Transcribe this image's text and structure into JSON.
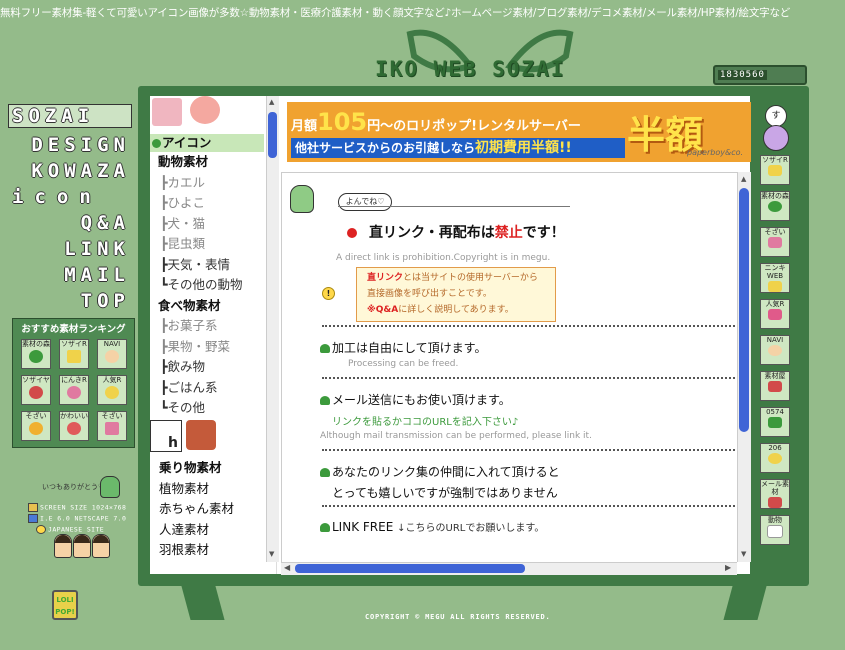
{
  "header": {
    "top_text": "無料フリー素材集-軽くて可愛いアイコン画像が多数☆動物素材・医療介護素材・動く顔文字など♪ホームページ素材/ブログ素材/デコメ素材/メール素材/HP素材/絵文字など",
    "logo": "IKO WEB SOZAI",
    "counter": "1830560"
  },
  "left_nav": {
    "items": [
      {
        "label": "SOZAI",
        "active": true
      },
      {
        "label": "DESIGN",
        "active": false
      },
      {
        "label": "KOWAZA",
        "active": false
      },
      {
        "label": "icon",
        "active": false
      },
      {
        "label": "Q&A",
        "active": false
      },
      {
        "label": "LINK",
        "active": false
      },
      {
        "label": "MAIL",
        "active": false
      },
      {
        "label": "TOP",
        "active": false
      }
    ]
  },
  "ranking": {
    "title": "おすすめ素材ランキング",
    "badges": [
      "素材の森",
      "ソザイR",
      "NAVI",
      "ソザイヤ",
      "にんきR",
      "人気R",
      "そざい",
      "かわいい",
      "そざい"
    ]
  },
  "site_info": {
    "thanks": "いつもありがとう♡",
    "screen": "SCREEN SIZE 1024×768",
    "browser": "I.E 6.0 NETSCAPE 7.0",
    "site": "JAPANESE SITE",
    "host_badge": "LOLI POP!"
  },
  "sidebar": {
    "list1": [
      {
        "label": "アイコン",
        "type": "head"
      },
      {
        "label": "動物素材",
        "type": "bold"
      },
      {
        "label": "┣カエル",
        "type": "sub"
      },
      {
        "label": "┣ひよこ",
        "type": "sub"
      },
      {
        "label": "┣犬・猫",
        "type": "sub"
      },
      {
        "label": "┣昆虫類",
        "type": "sub"
      },
      {
        "label": "┣天気・表情",
        "type": "sub-dark"
      },
      {
        "label": "┗その他の動物",
        "type": "sub-dark"
      },
      {
        "label": "食べ物素材",
        "type": "bold"
      },
      {
        "label": "┣お菓子系",
        "type": "sub"
      },
      {
        "label": "┣果物・野菜",
        "type": "sub"
      },
      {
        "label": "┣飲み物",
        "type": "sub-dark"
      },
      {
        "label": "┣ごはん系",
        "type": "sub-dark"
      },
      {
        "label": "┗その他",
        "type": "sub-dark"
      }
    ],
    "list2": [
      "乗り物素材",
      "植物素材",
      "赤ちゃん素材",
      "人達素材",
      "羽根素材"
    ]
  },
  "banner": {
    "line1_pre": "月額",
    "line1_price": "105",
    "line1_post": "円〜のロリポップ!レンタルサーバー",
    "line2_pre": "他社サービスからのお引越しなら",
    "line2_hl": "初期費用半額!!",
    "big": "半額",
    "brand": "paperboy&co."
  },
  "content": {
    "cloud": "よんでね♡",
    "warning_pre": "直リンク・再配布は",
    "warning_red": "禁止",
    "warning_post": "です！",
    "warning_en": "A direct link is prohibition.Copyright is in megu.",
    "notice": {
      "l1_red": "直リンク",
      "l1_rest": "とは当サイトの使用サーバーから",
      "l2": "直接画像を呼び出すことです。",
      "l3_red": "※Q&A",
      "l3_rest": "に詳しく説明してあります。"
    },
    "item1": "加工は自由にして頂けます。",
    "item1_en": "Processing can be freed.",
    "item2": "メール送信にもお使い頂けます。",
    "item2_jp": "リンクを貼るかココのURLを記入下さい♪",
    "item2_en": "Although mail transmission can be performed, please link it.",
    "item3_l1": "あなたのリンク集の仲間に入れて頂けると",
    "item3_l2": "とっても嬉しいですが強制ではありません",
    "item4": "LINK FREE",
    "item4_note": "↓こちらのURLでお願いします。"
  },
  "right_buttons": [
    "ソザイR",
    "素材の森",
    "そざい",
    "ニンキWEB",
    "人気R",
    "NAVI",
    "素材屋",
    "0574",
    "206",
    "メール素材",
    "動物"
  ],
  "footer": {
    "copyright": "COPYRIGHT © MEGU ALL RIGHTS RESERVED."
  },
  "colors": {
    "background": "#94bb8a",
    "frame": "#3f7a45",
    "scroll_thumb": "#3f64d6",
    "warning_red": "#dd2222",
    "notice_border": "#e29b4a"
  }
}
